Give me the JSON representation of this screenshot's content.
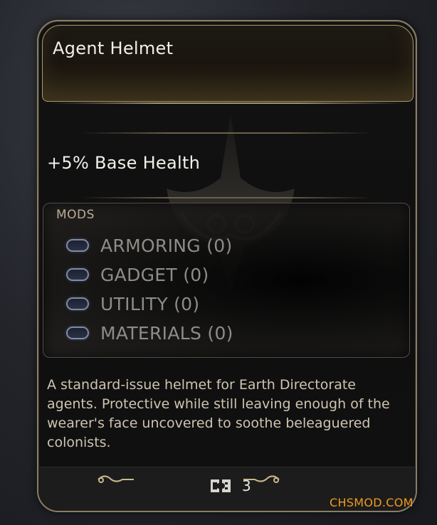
{
  "item": {
    "title": "Agent Helmet",
    "stat": "+5% Base Health",
    "description": "A standard-issue helmet for Earth Directorate agents. Protective while still leaving enough of the wearer's face uncovered to soothe beleaguered colonists."
  },
  "mods": {
    "label": "MODS",
    "slots": [
      {
        "label": "ARMORING (0)",
        "icon": "mod-slot-icon"
      },
      {
        "label": "GADGET (0)",
        "icon": "mod-slot-icon"
      },
      {
        "label": "UTILITY (0)",
        "icon": "mod-slot-icon"
      },
      {
        "label": "MATERIALS (0)",
        "icon": "mod-slot-icon"
      }
    ]
  },
  "footer": {
    "icon": "ticket-icon",
    "value": "3"
  },
  "watermark": "CHSMOD.COM",
  "colors": {
    "accent_gold": "#a9966e",
    "mod_icon_blue": "#7f8aa6",
    "watermark_orange": "#f09a20"
  }
}
